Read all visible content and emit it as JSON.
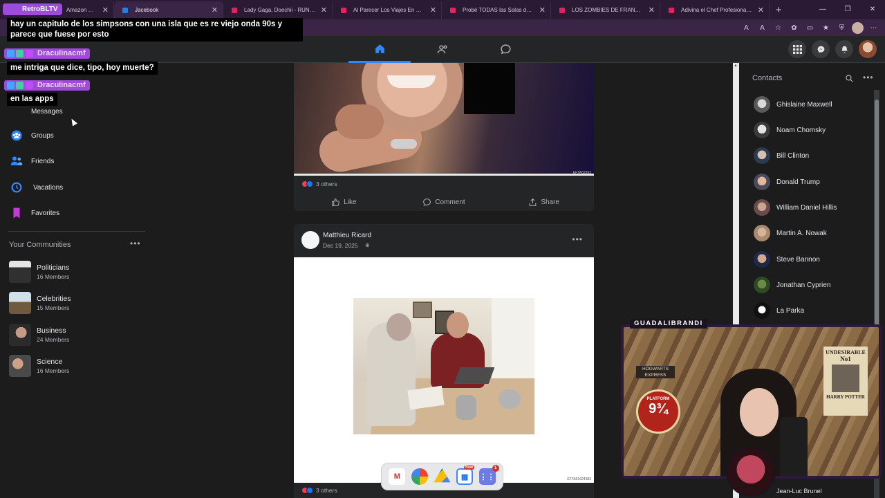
{
  "browser": {
    "tabs": [
      {
        "label": "Amazon Orde"
      },
      {
        "label": "Jacebook"
      },
      {
        "label": "Lady Gaga, Doechii - RUNWAY (Of"
      },
      {
        "label": "Al Parecer Los Viajes En El Tiempo"
      },
      {
        "label": "Probé TODAS las Salas de Cine en"
      },
      {
        "label": "LOS ZOMBIES DE FRANKFURT (JAP"
      },
      {
        "label": "Adivina el Chef Profesional - YouT"
      }
    ],
    "new_tab": "+"
  },
  "overlay": {
    "retro_badge": "RetroBLTV",
    "msg1": "hay un capitulo de los simpsons con una isla que es re viejo onda 90s y parece que fuese por esto",
    "user1": "Draculinacmf",
    "msg2": "me intriga que dice, tipo, hoy muerte?",
    "user2": "Draculinacmf",
    "msg3": "en las apps"
  },
  "sidebar": {
    "messages": "Messages",
    "groups": "Groups",
    "friends": "Friends",
    "vacations": "Vacations",
    "favorites": "Favorites",
    "communities_header": "Your Communities",
    "communities": [
      {
        "name": "Politicians",
        "members": "16 Members"
      },
      {
        "name": "Celebrities",
        "members": "15 Members"
      },
      {
        "name": "Business",
        "members": "24 Members"
      },
      {
        "name": "Science",
        "members": "16 Members"
      }
    ]
  },
  "feed": {
    "post1": {
      "photo_code": "EFTA02093",
      "reactions": "3 others",
      "like": "Like",
      "comment": "Comment",
      "share": "Share"
    },
    "post2": {
      "author": "Matthieu Ricard",
      "date": "Dec 19, 2025",
      "visibility_glyph": "⊕",
      "photo_code": "EFTA01624383",
      "reactions": "3 others"
    }
  },
  "contacts": {
    "title": "Contacts",
    "list": [
      {
        "name": "Ghislaine Maxwell"
      },
      {
        "name": "Noam Chomsky"
      },
      {
        "name": "Bill Clinton"
      },
      {
        "name": "Donald Trump"
      },
      {
        "name": "William Daniel Hillis"
      },
      {
        "name": "Martin A. Nowak"
      },
      {
        "name": "Steve Bannon"
      },
      {
        "name": "Jonathan Cyprien"
      },
      {
        "name": "La Parka"
      }
    ],
    "partial_last": "Jean-Luc Brunel"
  },
  "webcam": {
    "label": "GUADALIBRANDI",
    "hogwarts": "HOGWARTS EXPRESS",
    "platform_text": "PLATFORM",
    "platform_number": "9¾",
    "undesirable": "UNDESIRABLE",
    "undesirable_no": "No1",
    "harry": "HARRY POTTER"
  },
  "dock": {
    "new_badge": "New",
    "count_badge": "1"
  },
  "colors": {
    "accent": "#2d88ff",
    "chat_name_bg": "#9d4bd9",
    "browser_frame": "#3b2547"
  }
}
